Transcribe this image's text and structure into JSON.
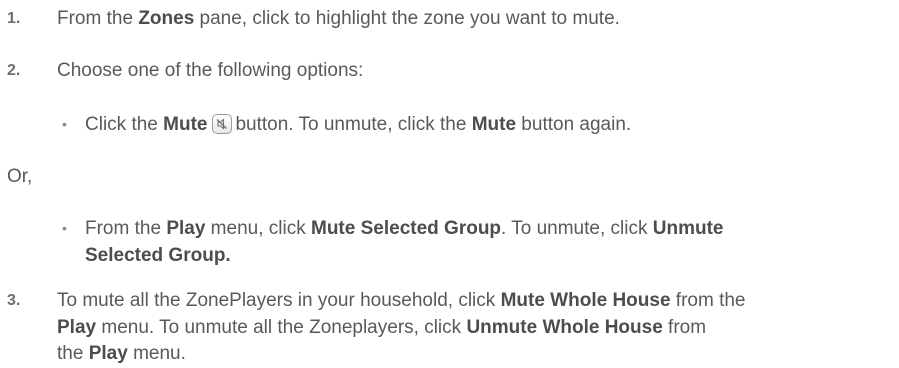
{
  "steps": [
    {
      "number": "1.",
      "parts": [
        "From the ",
        "Zones",
        " pane, click to highlight the zone you want to mute."
      ]
    },
    {
      "number": "2.",
      "text": "Choose one of the following options:"
    },
    {
      "bullet": "•",
      "parts": [
        "Click the ",
        "Mute",
        "button. To unmute, click the ",
        "Mute",
        " button again."
      ],
      "icon": "mute-icon"
    },
    {
      "text": "Or,"
    },
    {
      "bullet": "•",
      "line1": [
        "From the ",
        "Play",
        " menu, click ",
        "Mute Selected Group",
        ". To unmute, click ",
        "Unmute"
      ],
      "line2": [
        "Selected Group."
      ]
    },
    {
      "number": "3.",
      "line1": [
        "To mute all the ZonePlayers in your household, click ",
        "Mute Whole House",
        " from the"
      ],
      "line2": [
        "Play",
        " menu. To unmute all the Zoneplayers, click ",
        "Unmute Whole House",
        " from"
      ],
      "line3": [
        "the ",
        "Play",
        " menu."
      ]
    }
  ]
}
